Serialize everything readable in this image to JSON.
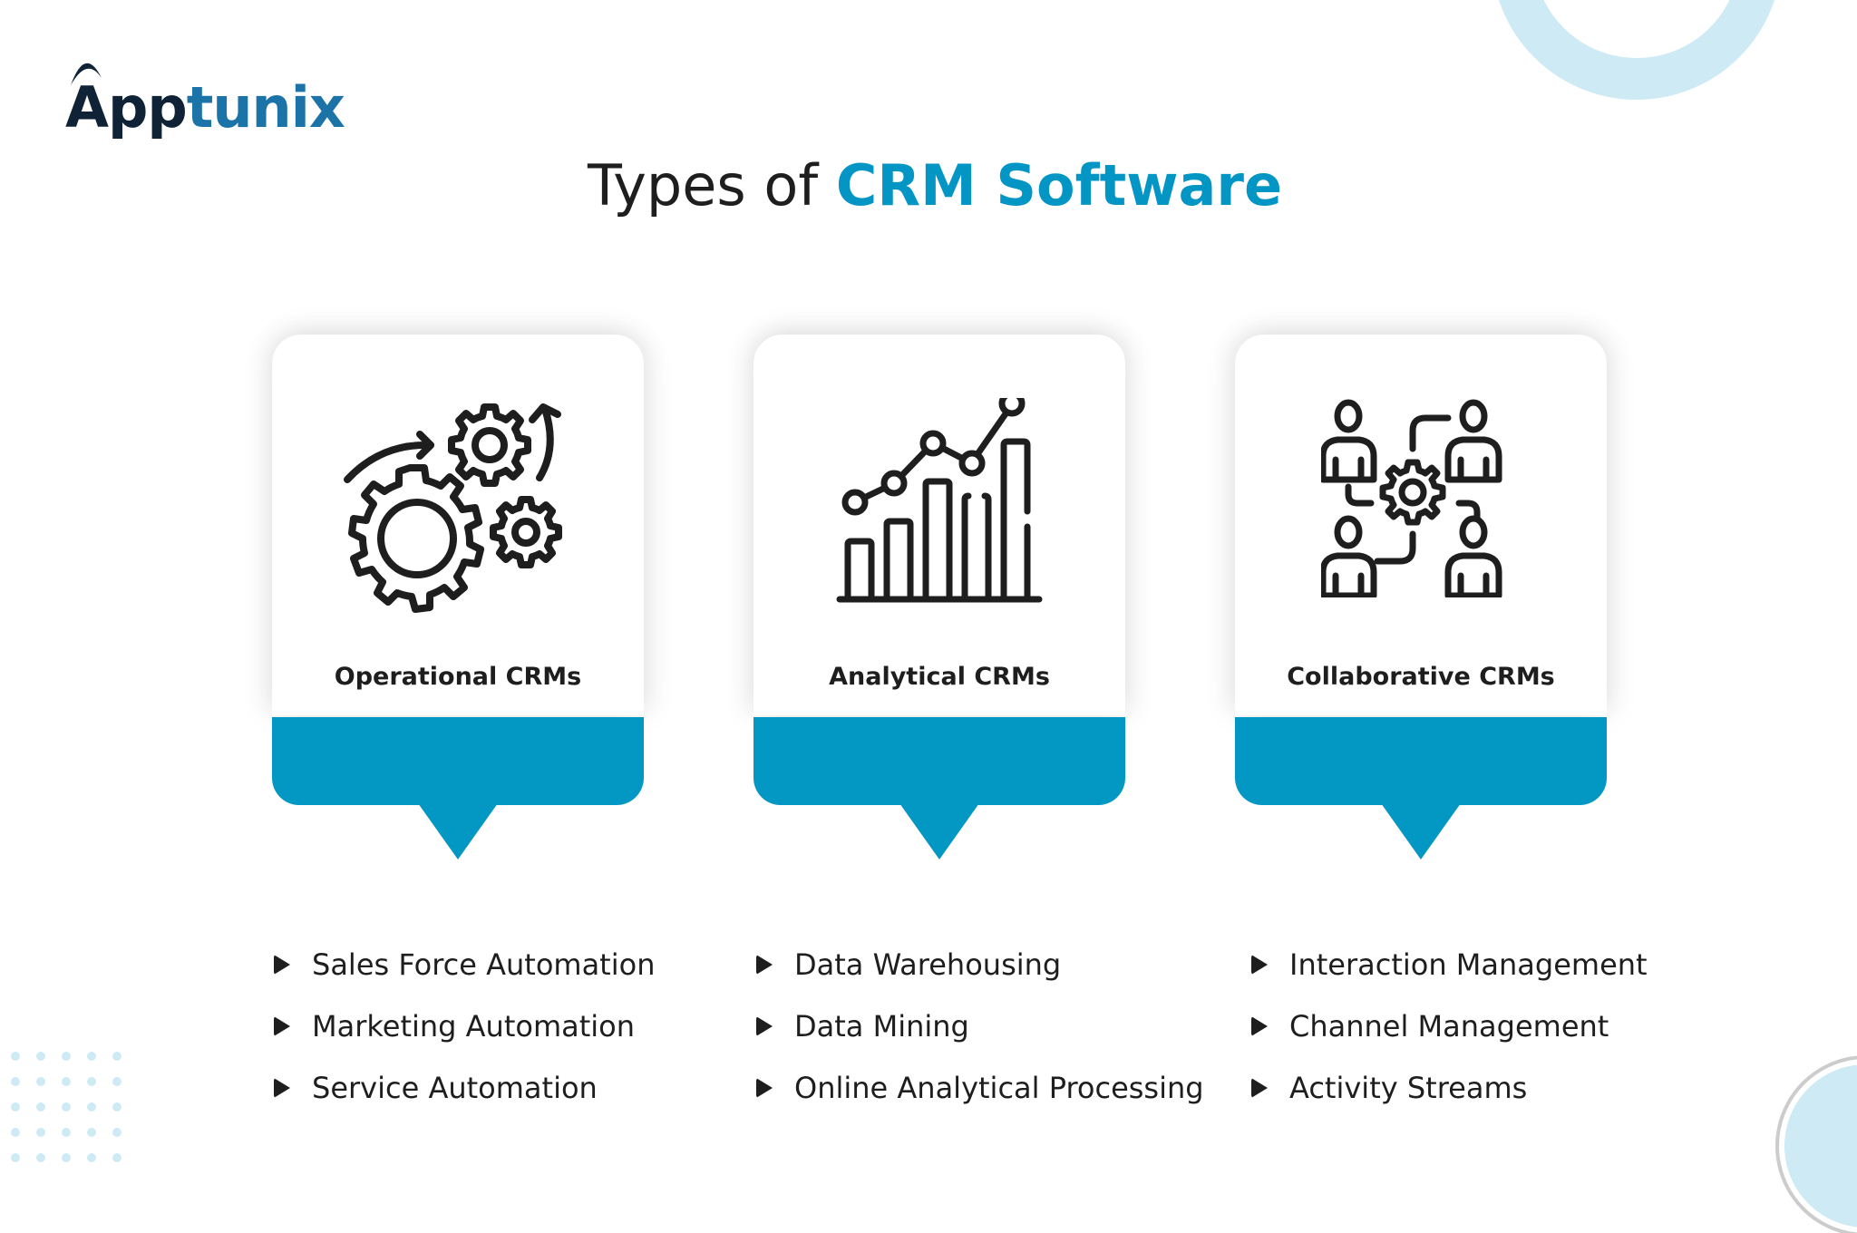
{
  "brand": {
    "logo_part1": "App",
    "logo_part2": "tunix",
    "colors": {
      "dark": "#0f2236",
      "blue": "#1b73a8"
    }
  },
  "title": {
    "plain": "Types of ",
    "accent": "CRM Software",
    "accent_color": "#0396c4"
  },
  "cards": [
    {
      "label": "Operational CRMs",
      "icon": "gears-icon",
      "items": [
        "Sales Force Automation",
        "Marketing Automation",
        "Service Automation"
      ]
    },
    {
      "label": "Analytical CRMs",
      "icon": "bar-line-chart-icon",
      "items": [
        "Data Warehousing",
        "Data Mining",
        "Online Analytical Processing"
      ]
    },
    {
      "label": "Collaborative CRMs",
      "icon": "team-network-icon",
      "items": [
        "Interaction Management",
        "Channel Management",
        "Activity Streams"
      ]
    }
  ],
  "theme": {
    "card_accent": "#0397c4",
    "decor": "#cdeaf5",
    "text": "#1e1e1e"
  }
}
